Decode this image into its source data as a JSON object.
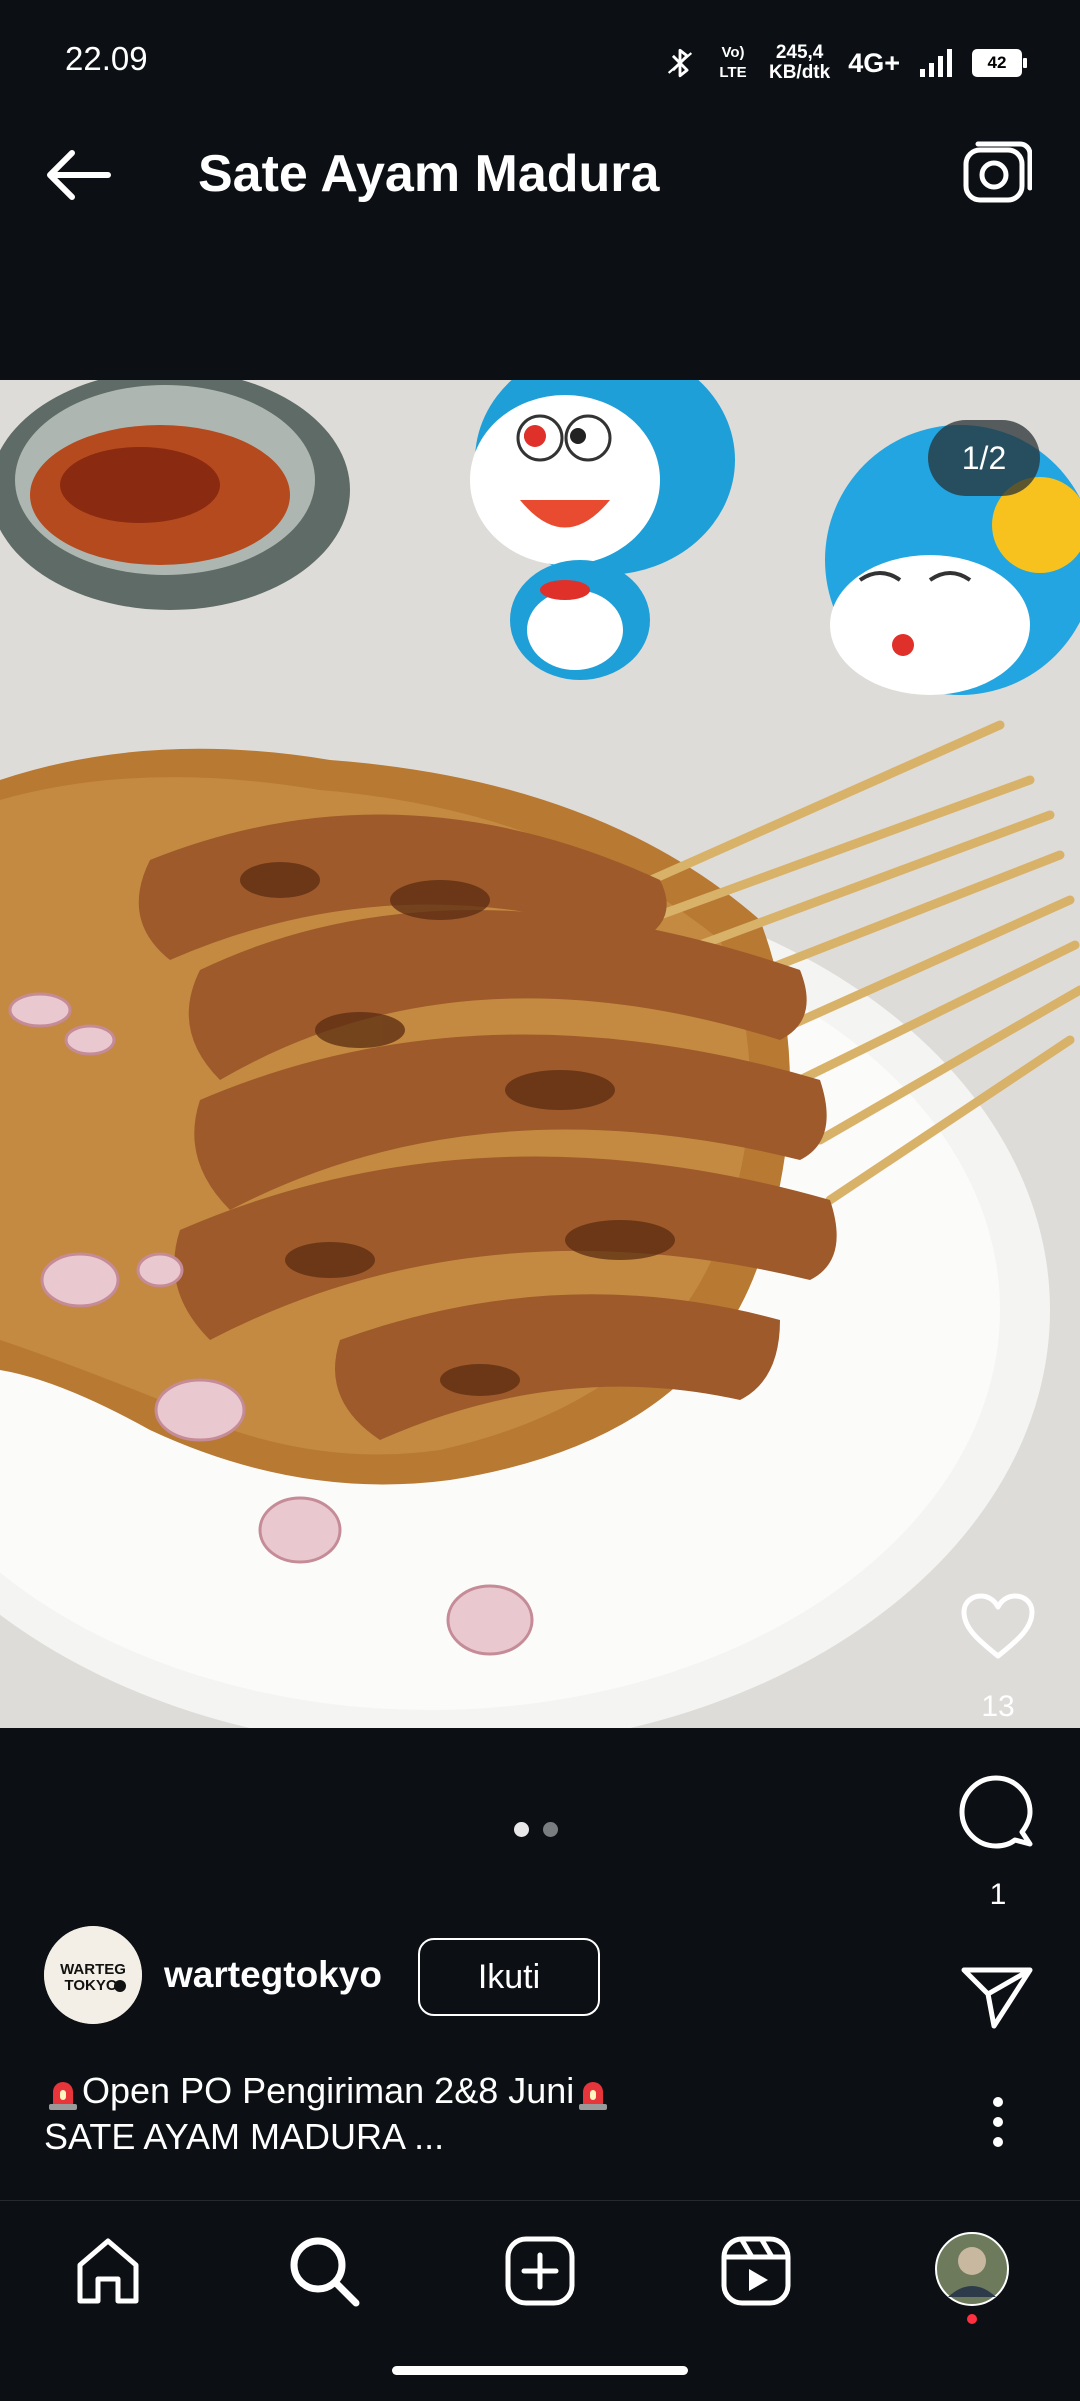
{
  "status_bar": {
    "time": "22.09",
    "speed_line1": "245,4",
    "speed_line2": "KB/dtk",
    "network": "4G+",
    "volte": "Vo) LTE",
    "battery": "42"
  },
  "header": {
    "title": "Sate Ayam Madura",
    "back_icon": "arrow-left-icon",
    "camera_icon": "camera-icon"
  },
  "media": {
    "counter": "1/2",
    "total_images": 2,
    "current_index": 1
  },
  "actions": {
    "like_count": "13",
    "comment_count": "1",
    "like_icon": "heart-icon",
    "comment_icon": "comment-icon",
    "share_icon": "paper-plane-icon",
    "more_icon": "more-vertical-icon"
  },
  "post": {
    "username": "wartegtokyo",
    "follow_label": "Ikuti",
    "caption_line1": "Open PO Pengiriman 2&8 Juni",
    "caption_line2": "SATE AYAM MADURA ...",
    "avatar_text": "WARTEG TOKYO"
  },
  "nav": {
    "items": [
      "home-icon",
      "search-icon",
      "add-post-icon",
      "reels-icon",
      "profile-avatar"
    ]
  },
  "colors": {
    "background": "#0c1014",
    "text": "#ffffff",
    "notification_dot": "#ff3040",
    "siren_red": "#e8353b"
  }
}
